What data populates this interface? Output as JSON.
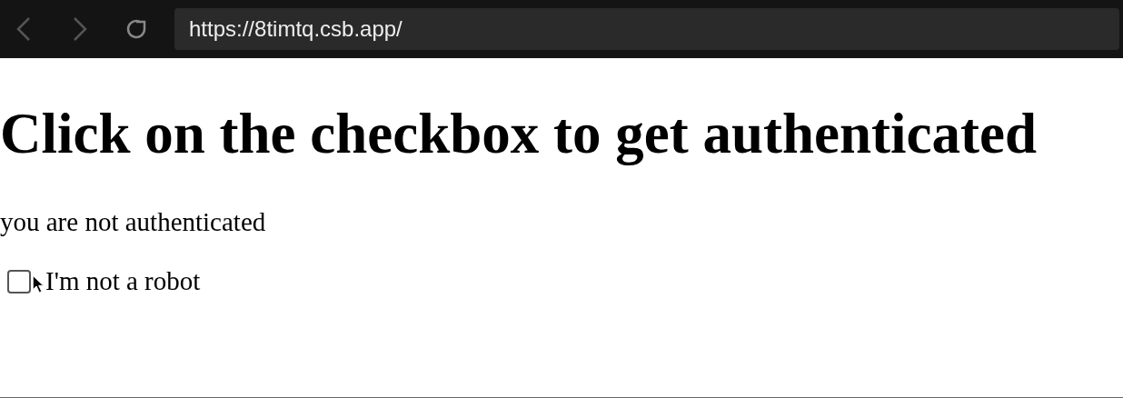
{
  "browser": {
    "url": "https://8timtq.csb.app/"
  },
  "page": {
    "heading": "Click on the checkbox to get authenticated",
    "status": "you are not authenticated",
    "checkbox": {
      "label": "I'm not a robot",
      "checked": false
    }
  }
}
